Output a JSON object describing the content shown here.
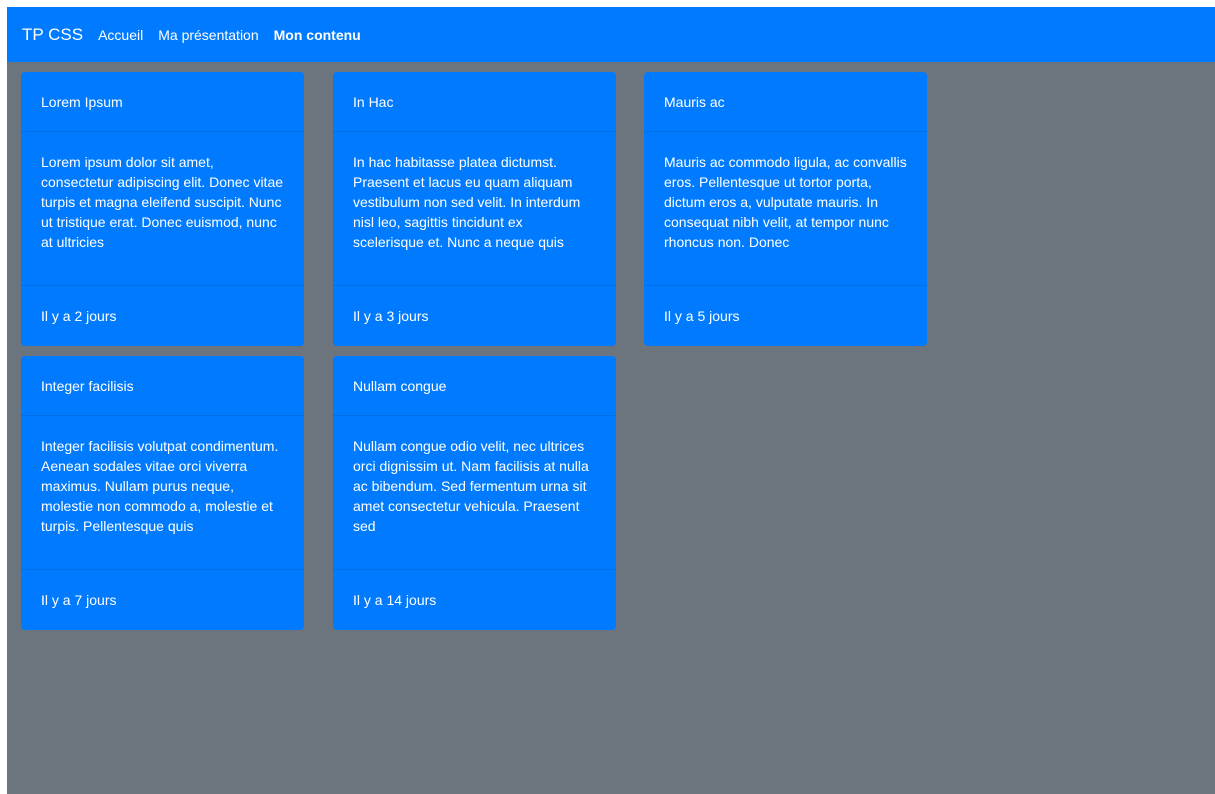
{
  "navbar": {
    "brand": "TP CSS",
    "links": [
      "Accueil",
      "Ma présentation",
      "Mon contenu"
    ],
    "active_link": "Mon contenu"
  },
  "colors": {
    "primary": "#007bff",
    "background": "#6c757d",
    "text": "#ffffff"
  },
  "cards": [
    {
      "title": "Lorem Ipsum",
      "body": "Lorem ipsum dolor sit amet, consectetur adipiscing elit. Donec vitae turpis et magna eleifend suscipit. Nunc ut tristique erat. Donec euismod, nunc at ultricies",
      "footer": "Il y a 2 jours"
    },
    {
      "title": "In Hac",
      "body": "In hac habitasse platea dictumst. Praesent et lacus eu quam aliquam vestibulum non sed velit. In interdum nisl leo, sagittis tincidunt ex scelerisque et. Nunc a neque quis",
      "footer": "Il y a 3 jours"
    },
    {
      "title": "Mauris ac",
      "body": "Mauris ac commodo ligula, ac convallis eros. Pellentesque ut tortor porta, dictum eros a, vulputate mauris. In consequat nibh velit, at tempor nunc rhoncus non. Donec",
      "footer": "Il y a 5 jours"
    },
    {
      "title": "Integer facilisis",
      "body": "Integer facilisis volutpat condimentum. Aenean sodales vitae orci viverra maximus. Nullam purus neque, molestie non commodo a, molestie et turpis. Pellentesque quis",
      "footer": "Il y a 7 jours"
    },
    {
      "title": "Nullam congue",
      "body": "Nullam congue odio velit, nec ultrices orci dignissim ut. Nam facilisis at nulla ac bibendum. Sed fermentum urna sit amet consectetur vehicula. Praesent sed",
      "footer": "Il y a 14 jours"
    }
  ]
}
